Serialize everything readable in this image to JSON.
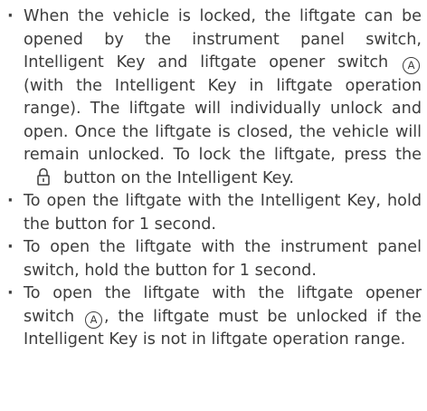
{
  "bullets": [
    {
      "parts": [
        "When the vehicle is locked, the liftgate can be opened by the instrument panel switch, Intelligent Key and liftgate opener switch",
        "(with the Intelligent Key in liftgate op­eration range). The liftgate will individually unlock and open. Once the liftgate is closed, the vehicle will remain unlocked. To lock the liftgate, press the",
        "button on the Intelligent Key."
      ],
      "marker": "A"
    },
    {
      "text": "To open the liftgate with the Intelligent Key, hold the button for 1 second."
    },
    {
      "text": "To open the liftgate with the instrument panel switch, hold the button for 1 second."
    },
    {
      "parts": [
        "To open the liftgate with the liftgate opener switch",
        ", the liftgate must be un­locked if the Intelligent Key is not in liftgate operation range."
      ],
      "marker": "A"
    }
  ],
  "icons": {
    "lock": "lock-icon"
  }
}
